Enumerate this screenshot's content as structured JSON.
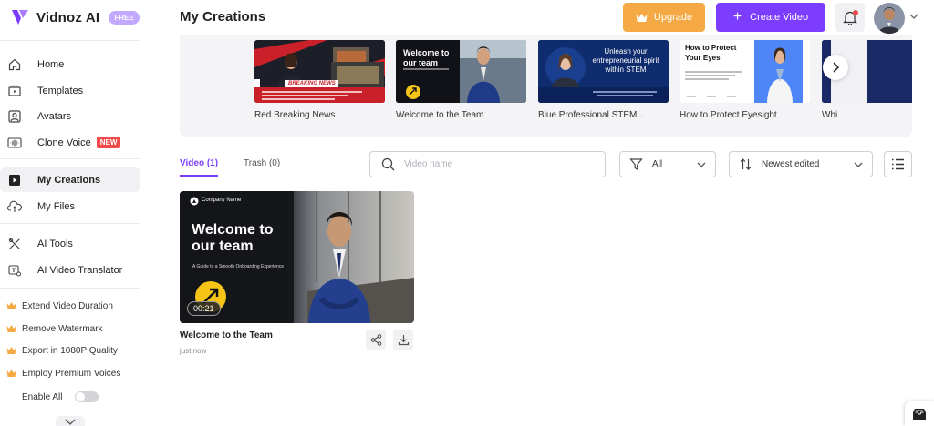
{
  "app": {
    "name": "Vidnoz AI",
    "plan_badge": "FREE"
  },
  "header": {
    "page_title": "My Creations",
    "upgrade_label": "Upgrade",
    "create_label": "Create Video",
    "create_plus": "+"
  },
  "sidebar": {
    "items": [
      {
        "label": "Home",
        "icon": "home-icon"
      },
      {
        "label": "Templates",
        "icon": "templates-icon"
      },
      {
        "label": "Avatars",
        "icon": "avatar-icon"
      },
      {
        "label": "Clone Voice",
        "icon": "voice-icon",
        "badge": "NEW"
      },
      {
        "label": "My Creations",
        "icon": "creations-icon",
        "active": true
      },
      {
        "label": "My Files",
        "icon": "upload-icon"
      },
      {
        "label": "AI Tools",
        "icon": "tools-icon"
      },
      {
        "label": "AI Video Translator",
        "icon": "translate-icon"
      }
    ],
    "premium": [
      {
        "label": "Extend Video Duration"
      },
      {
        "label": "Remove Watermark"
      },
      {
        "label": "Export in 1080P Quality"
      },
      {
        "label": "Employ Premium Voices"
      }
    ],
    "enable_all_label": "Enable All"
  },
  "templates": {
    "items": [
      {
        "label": "Red Breaking News",
        "banner": "BREAKING NEWS"
      },
      {
        "label": "Welcome to the Team",
        "heading": "Welcome to our team"
      },
      {
        "label": "Blue Professional STEM...",
        "heading": "Unleash your entrepreneurial spirit within STEM"
      },
      {
        "label": "How to Protect Eyesight",
        "heading": "How to Protect Your Eyes"
      },
      {
        "label": "Whi"
      }
    ]
  },
  "tabs": {
    "video": "Video (1)",
    "trash": "Trash (0)"
  },
  "filters": {
    "search_placeholder": "Video name",
    "type_value": "All",
    "sort_value": "Newest edited"
  },
  "videos": [
    {
      "title": "Welcome to the Team",
      "time": "just now",
      "duration": "00:21",
      "thumb_company": "Company Name",
      "thumb_heading_1": "Welcome to",
      "thumb_heading_2": "our team",
      "thumb_subtitle": "A Guide to a Smooth Onboarding Experience"
    }
  ],
  "colors": {
    "accent": "#7d3dff",
    "upgrade": "#f5a944",
    "badge_new": "#f04a4a",
    "free_badge": "#c3a8ff"
  }
}
